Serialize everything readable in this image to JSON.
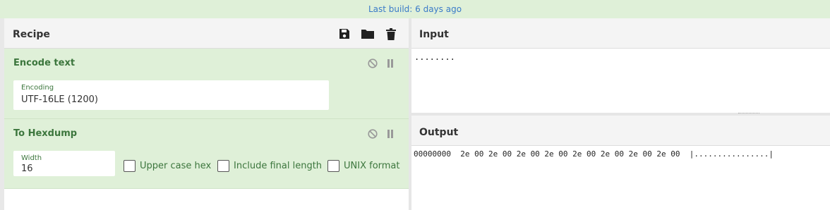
{
  "banner": {
    "text": "Last build: 6 days ago"
  },
  "recipe": {
    "title": "Recipe",
    "toolbar_icons": [
      "save-icon",
      "folder-icon",
      "trash-icon"
    ],
    "operations": [
      {
        "title": "Encode text",
        "fields": [
          {
            "label": "Encoding",
            "value": "UTF-16LE (1200)"
          }
        ]
      },
      {
        "title": "To Hexdump",
        "fields": [
          {
            "label": "Width",
            "value": "16"
          }
        ],
        "checkboxes": [
          {
            "label": "Upper case hex",
            "checked": false
          },
          {
            "label": "Include final length",
            "checked": false
          },
          {
            "label": "UNIX format",
            "checked": false
          }
        ]
      }
    ]
  },
  "input": {
    "title": "Input",
    "text": "........"
  },
  "output": {
    "title": "Output",
    "text": "00000000  2e 00 2e 00 2e 00 2e 00 2e 00 2e 00 2e 00 2e 00  |................|"
  },
  "colors": {
    "banner_bg": "#dff0d8",
    "op_bg": "#dff0d8",
    "op_title": "#3c763d",
    "banner_text": "#3a7bc8"
  }
}
